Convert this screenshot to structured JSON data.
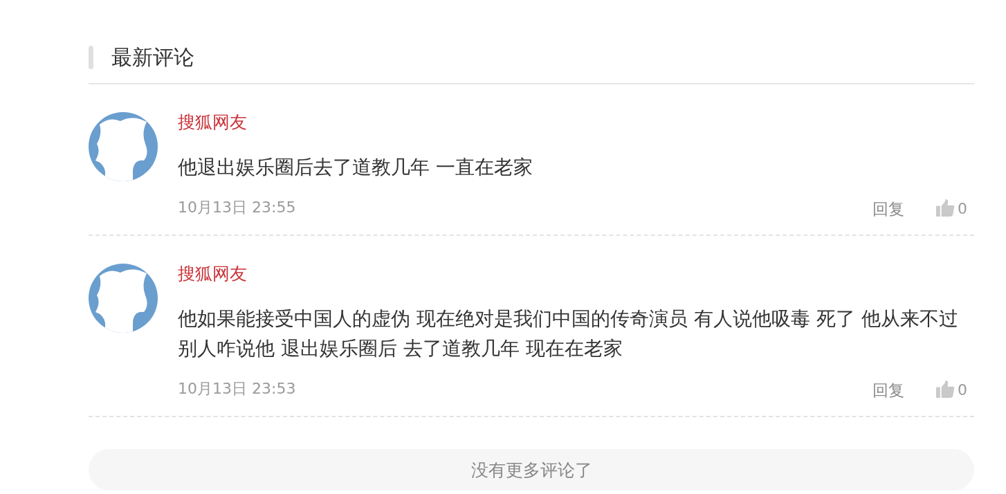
{
  "section": {
    "title": "最新评论"
  },
  "comments": [
    {
      "author": "搜狐网友",
      "text": "他退出娱乐圈后去了道教几年 一直在老家",
      "time": "10月13日 23:55",
      "reply": "回复",
      "likes": "0"
    },
    {
      "author": "搜狐网友",
      "text": "他如果能接受中国人的虚伪 现在绝对是我们中国的传奇演员 有人说他吸毒 死了 他从来不过别人咋说他 退出娱乐圈后 去了道教几年 现在在老家",
      "time": "10月13日 23:53",
      "reply": "回复",
      "likes": "0"
    }
  ],
  "footer": {
    "label": "没有更多评论了"
  }
}
